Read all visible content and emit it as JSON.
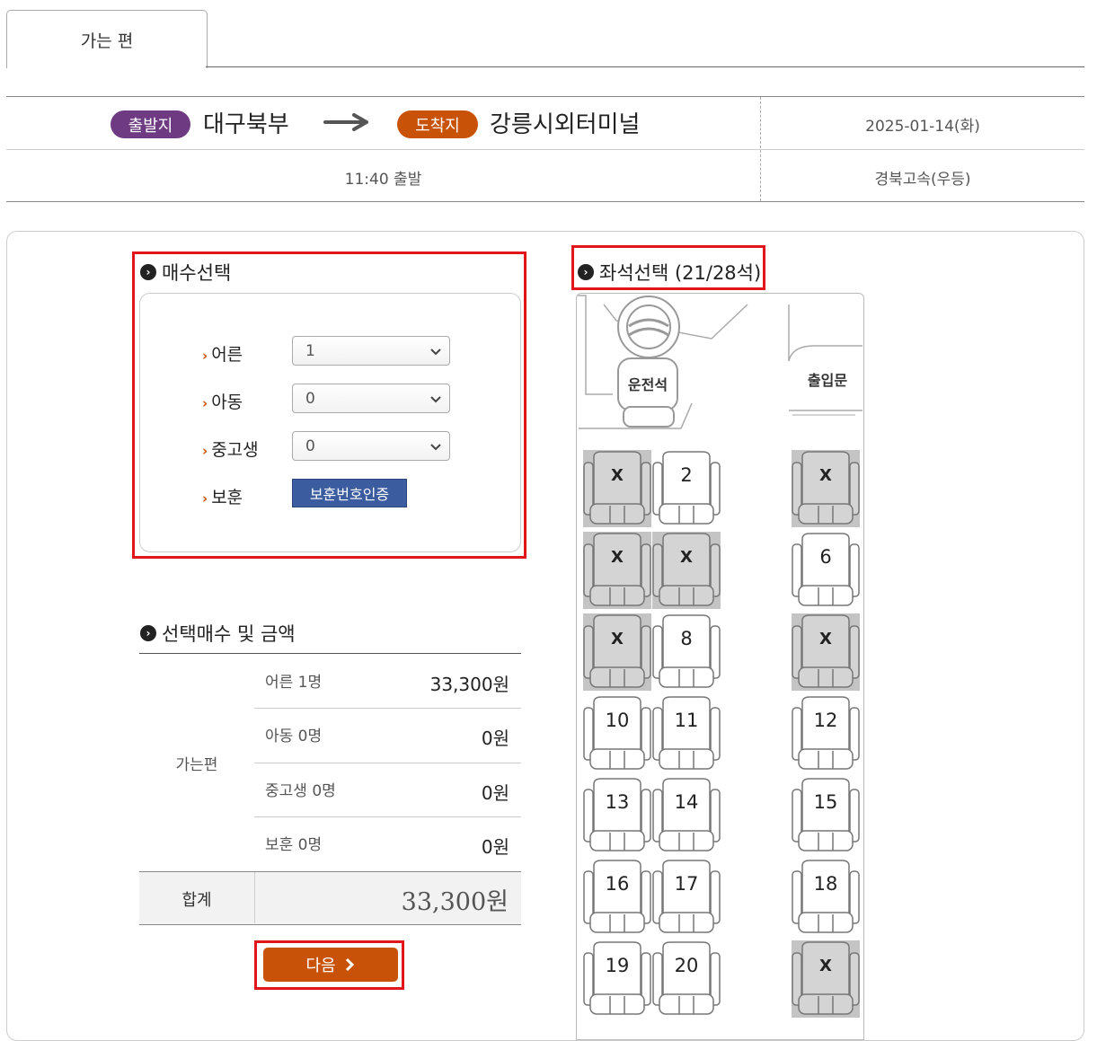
{
  "tab": {
    "label": "가는 편"
  },
  "route": {
    "departure_badge": "출발지",
    "departure": "대구북부",
    "arrival_badge": "도착지",
    "arrival": "강릉시외터미널",
    "date": "2025-01-14(화)",
    "departure_time": "11:40 출발",
    "route_name": "경북고속(우등)"
  },
  "ticket_select": {
    "title": "매수선택",
    "rows": [
      {
        "label": "어른",
        "value": "1"
      },
      {
        "label": "아동",
        "value": "0"
      },
      {
        "label": "중고생",
        "value": "0"
      }
    ],
    "veteran_label": "보훈",
    "veteran_button": "보훈번호인증"
  },
  "summary": {
    "title": "선택매수 및 금액",
    "group_label": "가는편",
    "rows": [
      {
        "label": "어른 1명",
        "amount": "33,300원"
      },
      {
        "label": "아동 0명",
        "amount": "0원"
      },
      {
        "label": "중고생 0명",
        "amount": "0원"
      },
      {
        "label": "보훈 0명",
        "amount": "0원"
      }
    ],
    "total_label": "합계",
    "total_amount": "33,300원"
  },
  "next_button": "다음",
  "seat_map": {
    "title": "좌석선택 (21/28석)",
    "driver_label": "운전석",
    "door_label": "출입문",
    "rows": [
      [
        "X",
        "2",
        "X"
      ],
      [
        "X",
        "X",
        "6"
      ],
      [
        "X",
        "8",
        "X"
      ],
      [
        "10",
        "11",
        "12"
      ],
      [
        "13",
        "14",
        "15"
      ],
      [
        "16",
        "17",
        "18"
      ],
      [
        "19",
        "20",
        "X"
      ]
    ]
  },
  "colors": {
    "departure": "#6e3a82",
    "arrival": "#c85208",
    "accent": "#c85208",
    "highlight": "#e0161c",
    "veteran_button": "#3b5c9e"
  }
}
